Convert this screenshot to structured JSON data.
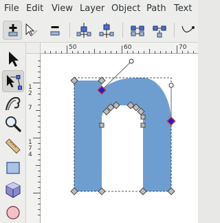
{
  "menubar": {
    "items": [
      "File",
      "Edit",
      "View",
      "Layer",
      "Object",
      "Path",
      "Text"
    ]
  },
  "toolbar": {
    "buttons": [
      "insert-node-icon",
      "break-path-icon",
      "delete-node-icon",
      "join-nodes-icon",
      "join-segment-icon",
      "convert-nodes-icon",
      "make-node-cusp-icon",
      "make-node-smooth-icon",
      "bezier-curve-icon"
    ]
  },
  "toolbox": {
    "tools": [
      "selector-tool-icon",
      "node-tool-icon",
      "tweak-tool-icon",
      "zoom-tool-icon",
      "measure-tool-icon",
      "rectangle-tool-icon",
      "3d-box-tool-icon",
      "ellipse-tool-icon"
    ],
    "active_tool": "node-tool-icon"
  },
  "rulers": {
    "horizontal_labels": [
      "50",
      "60",
      "70"
    ],
    "vertical_labels": [
      "1",
      "2",
      "7",
      "1",
      "7",
      "4"
    ]
  },
  "canvas": {
    "shape_fill": "#6e9ecf",
    "handle_color": "#505050",
    "selected_node_color": "#1d1dd4",
    "selected_node_alt_color": "#c83232"
  }
}
